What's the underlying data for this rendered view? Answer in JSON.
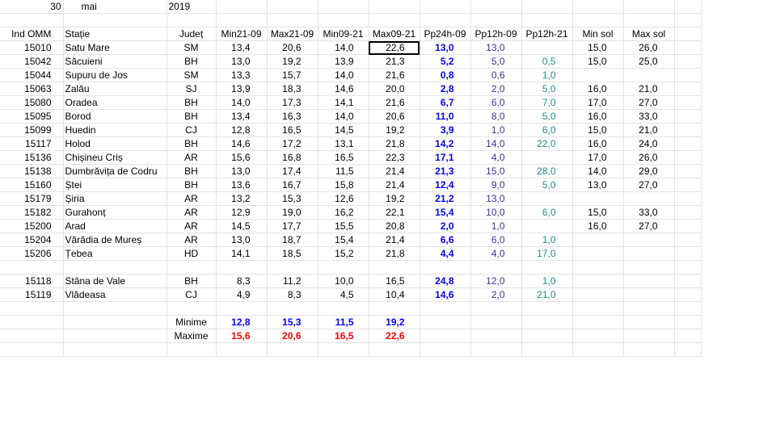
{
  "date": {
    "day": "30",
    "month": "mai",
    "year": "2019"
  },
  "headers": [
    "Ind OMM",
    "Stație",
    "Județ",
    "Min21-09",
    "Max21-09",
    "Min09-21",
    "Max09-21",
    "Pp24h-09",
    "Pp12h-09",
    "Pp12h-21",
    "Min sol",
    "Max sol"
  ],
  "stations_a": [
    [
      "15010",
      "Satu Mare",
      "SM",
      "13,4",
      "20,6",
      "14,0",
      "22,6",
      "13,0",
      "13,0",
      "",
      "15,0",
      "26,0"
    ],
    [
      "15042",
      "Săcuieni",
      "BH",
      "13,0",
      "19,2",
      "13,9",
      "21,3",
      "5,2",
      "5,0",
      "0,5",
      "15,0",
      "25,0"
    ],
    [
      "15044",
      "Supuru de Jos",
      "SM",
      "13,3",
      "15,7",
      "14,0",
      "21,6",
      "0,8",
      "0,6",
      "1,0",
      "",
      ""
    ],
    [
      "15063",
      "Zalău",
      "SJ",
      "13,9",
      "18,3",
      "14,6",
      "20,0",
      "2,8",
      "2,0",
      "5,0",
      "16,0",
      "21,0"
    ],
    [
      "15080",
      "Oradea",
      "BH",
      "14,0",
      "17,3",
      "14,1",
      "21,6",
      "6,7",
      "6,0",
      "7,0",
      "17,0",
      "27,0"
    ],
    [
      "15095",
      "Borod",
      "BH",
      "13,4",
      "16,3",
      "14,0",
      "20,6",
      "11,0",
      "8,0",
      "5,0",
      "16,0",
      "33,0"
    ],
    [
      "15099",
      "Huedin",
      "CJ",
      "12,8",
      "16,5",
      "14,5",
      "19,2",
      "3,9",
      "1,0",
      "6,0",
      "15,0",
      "21,0"
    ],
    [
      "15117",
      "Holod",
      "BH",
      "14,6",
      "17,2",
      "13,1",
      "21,8",
      "14,2",
      "14,0",
      "22,0",
      "16,0",
      "24,0"
    ],
    [
      "15136",
      "Chișineu    Criș",
      "AR",
      "15,6",
      "16,8",
      "16,5",
      "22,3",
      "17,1",
      "4,0",
      "",
      "17,0",
      "26,0"
    ],
    [
      "15138",
      "Dumbrăvița de Codru",
      "BH",
      "13,0",
      "17,4",
      "11,5",
      "21,4",
      "21,3",
      "15,0",
      "28,0",
      "14,0",
      "29,0"
    ],
    [
      "15160",
      "Ștei",
      "BH",
      "13,6",
      "16,7",
      "15,8",
      "21,4",
      "12,4",
      "9,0",
      "5,0",
      "13,0",
      "27,0"
    ],
    [
      "15179",
      "Șiria",
      "AR",
      "13,2",
      "15,3",
      "12,6",
      "19,2",
      "21,2",
      "13,0",
      "",
      "",
      ""
    ],
    [
      "15182",
      "Gurahonț",
      "AR",
      "12,9",
      "19,0",
      "16,2",
      "22,1",
      "15,4",
      "10,0",
      "6,0",
      "15,0",
      "33,0"
    ],
    [
      "15200",
      "Arad",
      "AR",
      "14,5",
      "17,7",
      "15,5",
      "20,8",
      "2,0",
      "1,0",
      "",
      "16,0",
      "27,0"
    ],
    [
      "15204",
      "Vărădia de Mureș",
      "AR",
      "13,0",
      "18,7",
      "15,4",
      "21,4",
      "6,6",
      "6,0",
      "1,0",
      "",
      ""
    ],
    [
      "15206",
      "Țebea",
      "HD",
      "14,1",
      "18,5",
      "15,2",
      "21,8",
      "4,4",
      "4,0",
      "17,0",
      "",
      ""
    ]
  ],
  "stations_b": [
    [
      "15118",
      "Stâna de Vale",
      "BH",
      "8,3",
      "11,2",
      "10,0",
      "16,5",
      "24,8",
      "12,0",
      "1,0",
      "",
      ""
    ],
    [
      "15119",
      "Vlădeasa",
      "CJ",
      "4,9",
      "8,3",
      "4,5",
      "10,4",
      "14,6",
      "2,0",
      "21,0",
      "",
      ""
    ]
  ],
  "summary": {
    "min_label": "Minime",
    "max_label": "Maxime",
    "min_values": [
      "12,8",
      "15,3",
      "11,5",
      "19,2"
    ],
    "max_values": [
      "15,6",
      "20,6",
      "16,5",
      "22,6"
    ]
  },
  "colors": {
    "pp24": "#0000ff",
    "pp12_09": "#3333aa",
    "pp12_21": "#1f8f8f",
    "maxime": "#ff0000",
    "grid": "#e3e3e3"
  }
}
